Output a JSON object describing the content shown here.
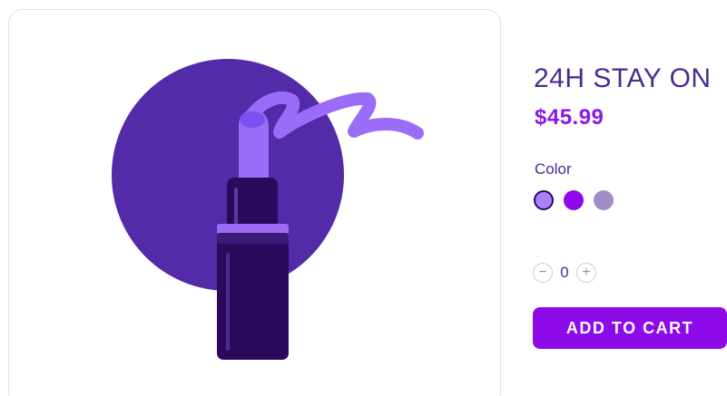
{
  "product": {
    "title": "24H STAY ON",
    "price": "$45.99",
    "image_icon": "lipstick-illustration"
  },
  "color_picker": {
    "label": "Color",
    "swatches": [
      {
        "color": "#a883f8",
        "selected": true
      },
      {
        "color": "#8d0be8",
        "selected": false
      },
      {
        "color": "#a38bc8",
        "selected": false
      }
    ]
  },
  "quantity": {
    "value": "0",
    "decrement_symbol": "−",
    "increment_symbol": "+"
  },
  "cart": {
    "add_label": "ADD TO CART"
  },
  "colors": {
    "accent": "#8d0be8",
    "title": "#4c2a8f",
    "circle": "#532ba8",
    "lipstick_bullet": "#9b6cf8",
    "lipstick_case": "#2b0a5e"
  }
}
